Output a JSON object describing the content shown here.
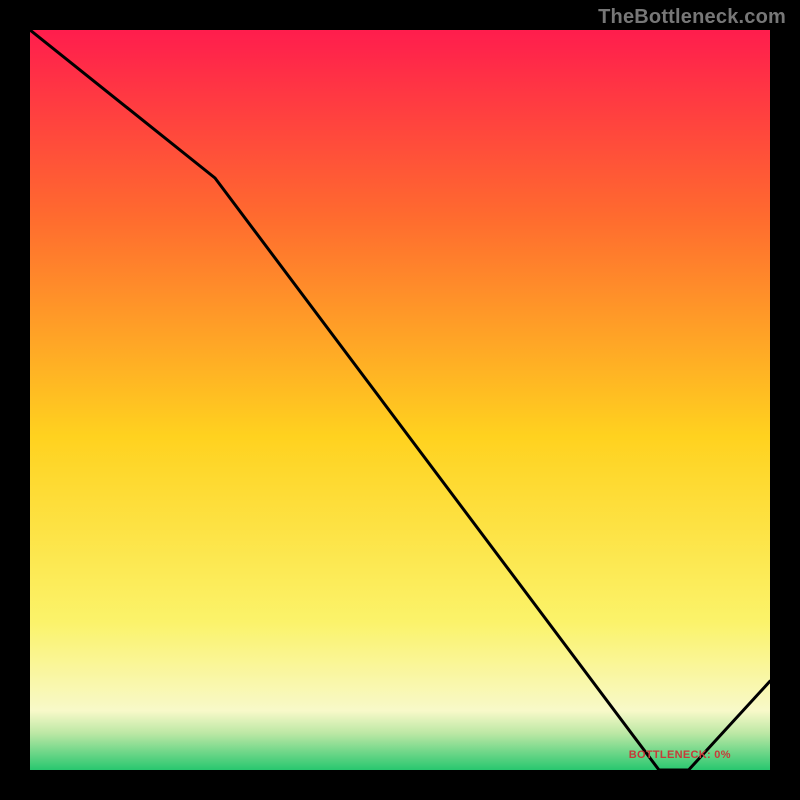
{
  "attribution": "TheBottleneck.com",
  "chart_data": {
    "type": "line",
    "title": "",
    "xlabel": "",
    "ylabel": "",
    "xlim": [
      0,
      100
    ],
    "ylim": [
      0,
      100
    ],
    "x": [
      0,
      25,
      85,
      89,
      100
    ],
    "values": [
      100,
      80,
      0,
      0,
      12
    ],
    "annotations": [
      {
        "x": 87,
        "y": 1,
        "text": "BOTTLENECK: 0%"
      }
    ],
    "background_gradient": {
      "stops": [
        {
          "offset": 0.0,
          "color": "#ff1d4d"
        },
        {
          "offset": 0.25,
          "color": "#ff6a2f"
        },
        {
          "offset": 0.55,
          "color": "#ffd21f"
        },
        {
          "offset": 0.8,
          "color": "#fbf36a"
        },
        {
          "offset": 0.92,
          "color": "#f8f9c9"
        },
        {
          "offset": 0.95,
          "color": "#bde8a5"
        },
        {
          "offset": 1.0,
          "color": "#28c76f"
        }
      ]
    },
    "line_color": "#000000"
  }
}
